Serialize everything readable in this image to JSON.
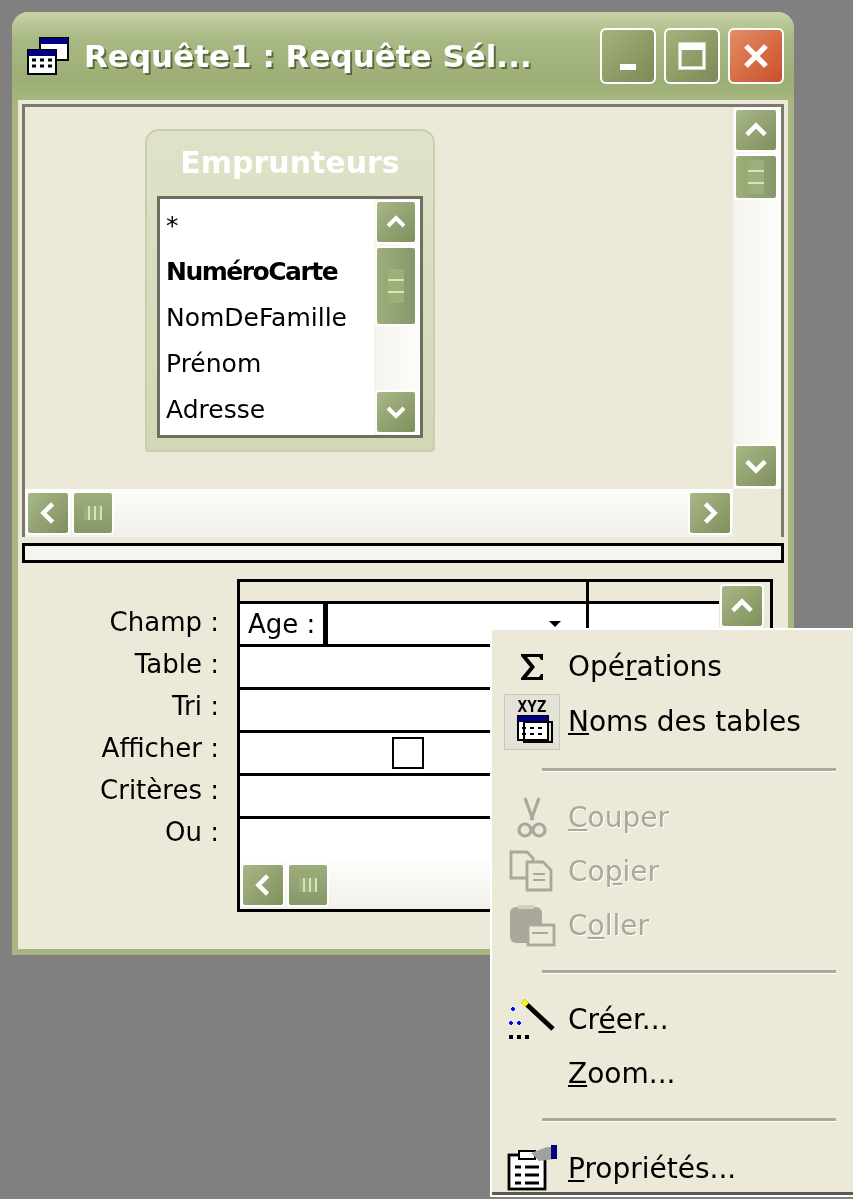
{
  "window": {
    "title": "Requête1 : Requête Sél..."
  },
  "table_box": {
    "title": "Emprunteurs",
    "fields": [
      {
        "name": "*",
        "key": false
      },
      {
        "name": "NuméroCarte",
        "key": true
      },
      {
        "name": "NomDeFamille",
        "key": false
      },
      {
        "name": "Prénom",
        "key": false
      },
      {
        "name": "Adresse",
        "key": false
      }
    ]
  },
  "grid": {
    "row_labels": [
      "Champ :",
      "Table :",
      "Tri :",
      "Afficher :",
      "Critères :",
      "Ou :"
    ],
    "field_value": "Age :",
    "show_checked": false
  },
  "context_menu": {
    "items": [
      {
        "kind": "item",
        "pre": "Opé",
        "key": "r",
        "post": "ations",
        "disabled": false
      },
      {
        "kind": "item",
        "icon_text": "XYZ",
        "key": "N",
        "post": "oms des tables",
        "disabled": false
      },
      {
        "kind": "separator"
      },
      {
        "kind": "item",
        "key": "C",
        "post": "ouper",
        "disabled": true
      },
      {
        "kind": "item",
        "pre": "Co",
        "key": "p",
        "post": "ier",
        "disabled": true
      },
      {
        "kind": "item",
        "pre": "C",
        "key": "o",
        "post": "ller",
        "disabled": true
      },
      {
        "kind": "separator"
      },
      {
        "kind": "item",
        "pre": "Cr",
        "key": "é",
        "post": "er...",
        "disabled": false
      },
      {
        "kind": "item",
        "key": "Z",
        "post": "oom...",
        "disabled": false
      },
      {
        "kind": "separator"
      },
      {
        "kind": "item",
        "key": "P",
        "post": "ropriétés...",
        "disabled": false
      }
    ]
  }
}
